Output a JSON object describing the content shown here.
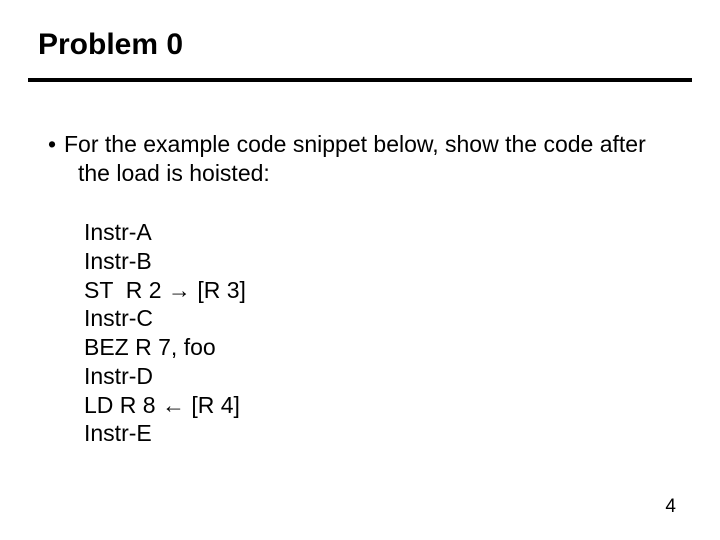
{
  "title": "Problem 0",
  "bullet": {
    "marker": "•",
    "line1": "For the example code snippet below, show the code after",
    "line2": "the load is hoisted:"
  },
  "code": [
    "Instr-A",
    "Instr-B",
    "ST  R 2 → [R 3]",
    "Instr-C",
    "BEZ R 7, foo",
    "Instr-D",
    "LD R 8 ← [R 4]",
    "Instr-E"
  ],
  "page_number": "4"
}
